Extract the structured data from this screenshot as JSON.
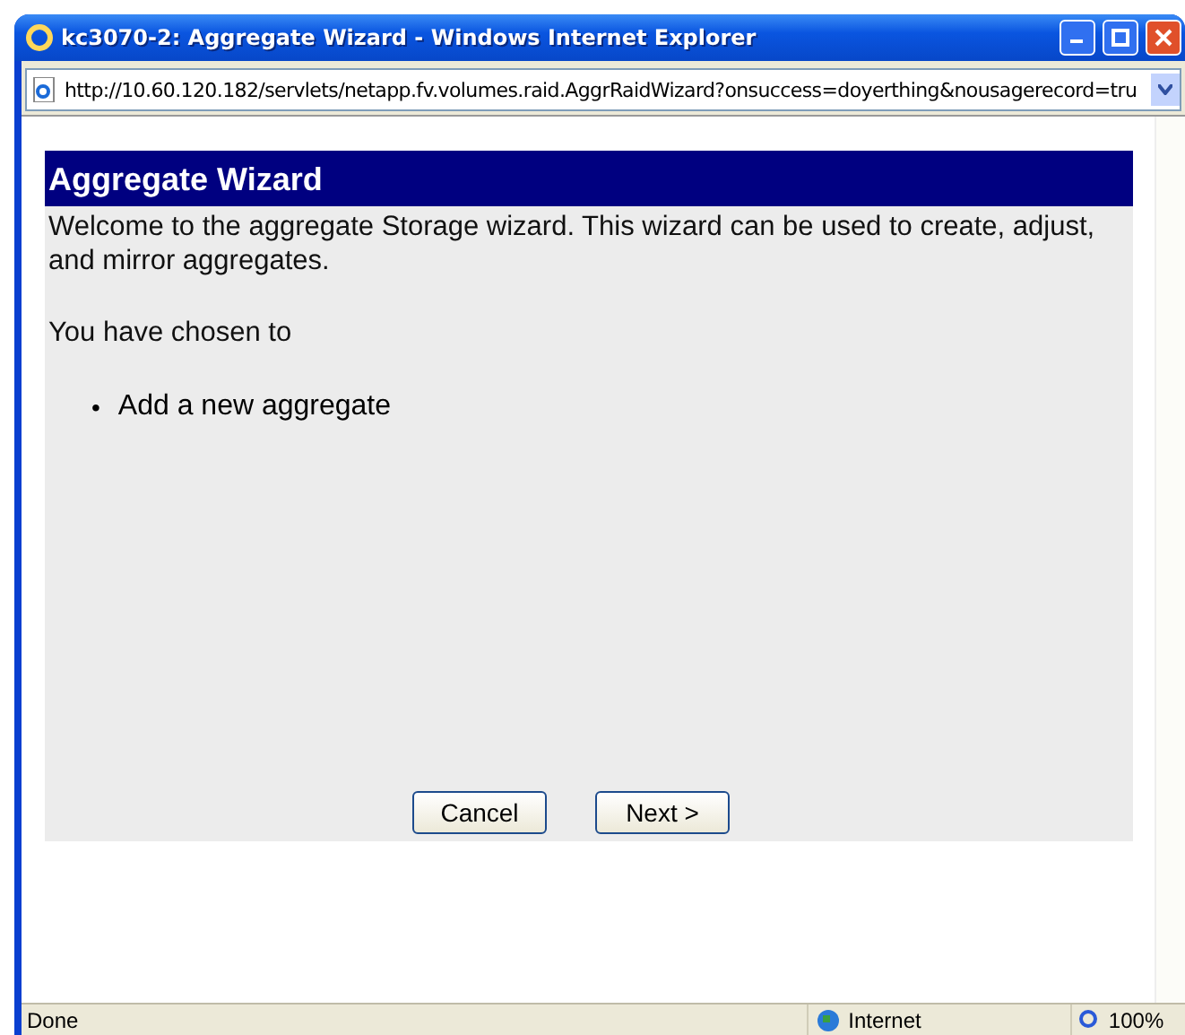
{
  "window": {
    "title": "kc3070-2: Aggregate Wizard - Windows Internet Explorer"
  },
  "address_bar": {
    "url": "http://10.60.120.182/servlets/netapp.fv.volumes.raid.AggrRaidWizard?onsuccess=doyerthing&nousagerecord=tru"
  },
  "wizard": {
    "title": "Aggregate Wizard",
    "intro": "Welcome to the aggregate Storage wizard. This wizard can be used to create, adjust, and mirror aggregates.",
    "chosen_label": "You have chosen to",
    "choices": [
      {
        "bullet": "•",
        "text": "Add a new aggregate"
      }
    ],
    "buttons": [
      {
        "label": "Cancel"
      },
      {
        "label": "Next >"
      }
    ]
  },
  "status_bar": {
    "text": "Done",
    "zone": "Internet",
    "zoom": "100%"
  }
}
